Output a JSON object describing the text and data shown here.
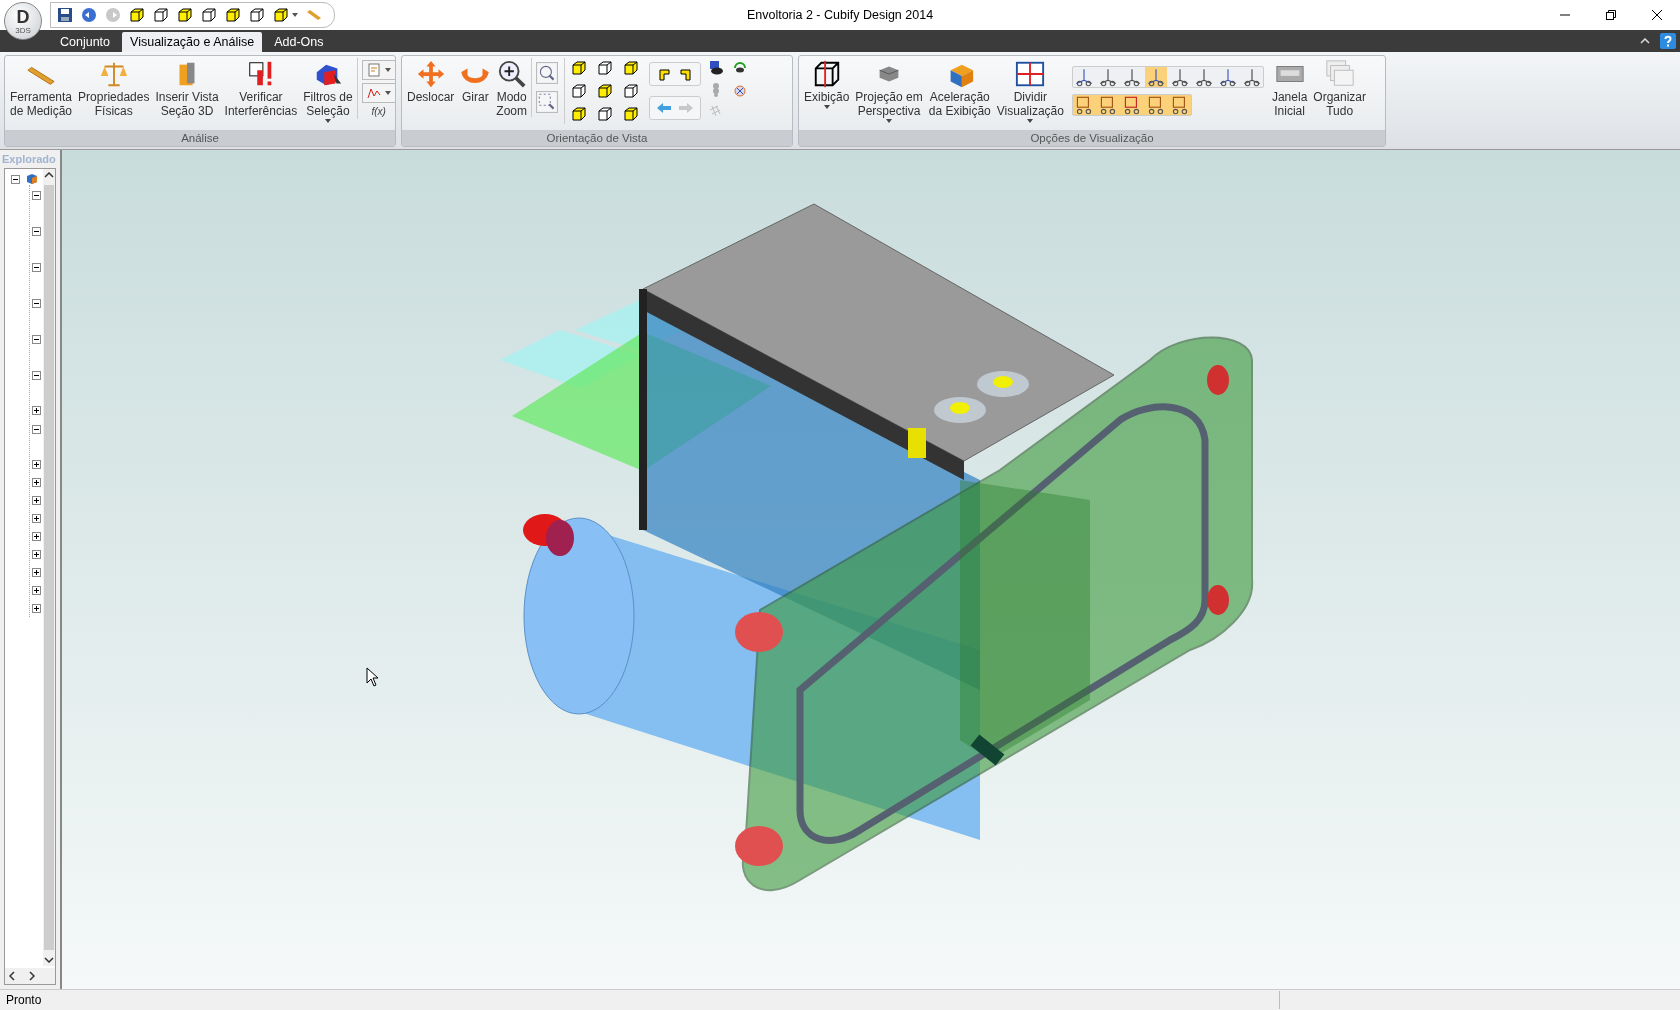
{
  "window": {
    "title": "Envoltoria 2 - Cubify Design 2014"
  },
  "app_logo": {
    "letter": "D",
    "sub": "3DS"
  },
  "ribbon": {
    "tabs": [
      {
        "label": "Conjunto",
        "selected": false
      },
      {
        "label": "Visualização e Análise",
        "selected": true
      },
      {
        "label": "Add-Ons",
        "selected": false
      }
    ],
    "groups": [
      {
        "title": "Análise",
        "buttons": [
          {
            "label": "Ferramenta\nde Medição",
            "dropdown": false
          },
          {
            "label": "Propriedades\nFísicas",
            "dropdown": false
          },
          {
            "label": "Inserir Vista\nSeção 3D",
            "dropdown": false
          },
          {
            "label": "Verificar\nInterferências",
            "dropdown": false
          },
          {
            "label": "Filtros de\nSeleção",
            "dropdown": true
          }
        ],
        "formula_label": "f(x)"
      },
      {
        "title": "Orientação de Vista",
        "buttons": [
          {
            "label": "Deslocar",
            "dropdown": false
          },
          {
            "label": "Girar",
            "dropdown": false
          },
          {
            "label": "Modo\nZoom",
            "dropdown": false
          }
        ]
      },
      {
        "title": "Opções de Visualização",
        "buttons": [
          {
            "label": "Exibição",
            "dropdown": true
          },
          {
            "label": "Projeção em\nPerspectiva",
            "dropdown": true
          },
          {
            "label": "Aceleração\nda Exibição",
            "dropdown": false
          },
          {
            "label": "Dividir\nVisualização",
            "dropdown": true
          },
          {
            "label": "Janela\nInicial",
            "dropdown": false
          },
          {
            "label": "Organizar\nTudo",
            "dropdown": false
          }
        ]
      }
    ]
  },
  "explorer": {
    "title": "Explorado",
    "tree": [
      {
        "expanded": true,
        "children": [
          {
            "expanded": true
          },
          {
            "expanded": true
          },
          {
            "expanded": true
          },
          {
            "expanded": true
          },
          {
            "expanded": true
          },
          {
            "expanded": true
          },
          {
            "expanded": false
          },
          {
            "expanded": true
          },
          {
            "expanded": false
          },
          {
            "expanded": false
          },
          {
            "expanded": false
          },
          {
            "expanded": false
          },
          {
            "expanded": false
          },
          {
            "expanded": false
          },
          {
            "expanded": false
          },
          {
            "expanded": false
          },
          {
            "expanded": false
          }
        ]
      }
    ]
  },
  "status_bar": {
    "text": "Pronto"
  }
}
